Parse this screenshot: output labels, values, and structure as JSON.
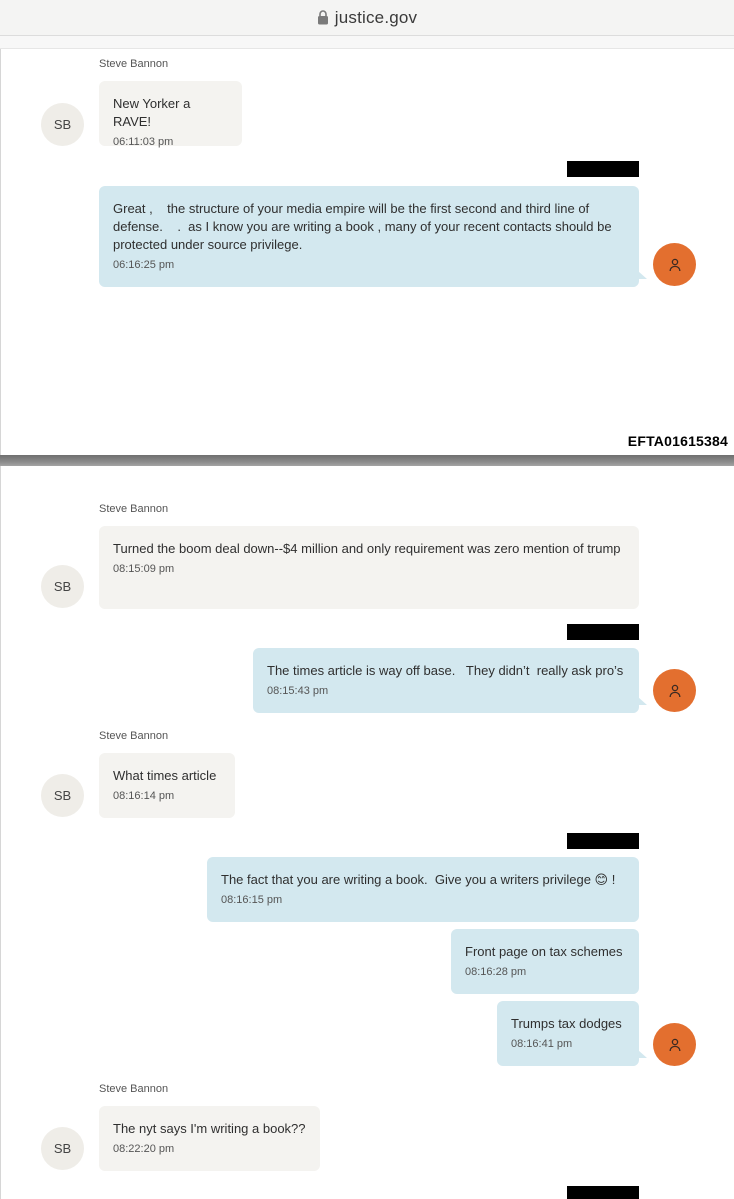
{
  "browser": {
    "url": "justice.gov"
  },
  "doc_id": "EFTA01615384",
  "contact": {
    "name": "Steve Bannon",
    "initials": "SB"
  },
  "page1": {
    "sender_1": "Steve Bannon",
    "msg_1": {
      "text": "New Yorker a RAVE!",
      "time": "06:11:03 pm"
    },
    "msg_2": {
      "text": "Great ,    the structure of your media empire will be the first second and third line of defense.    .  as I know you are writing a book , many of your recent contacts should be protected under source privilege.",
      "time": "06:16:25 pm"
    }
  },
  "page2": {
    "sender_1": "Steve Bannon",
    "msg_1": {
      "text": "Turned the boom deal down--$4 million and only requirement was zero mention of trump",
      "time": "08:15:09 pm"
    },
    "msg_2": {
      "text": "The times article is way off base.   They didn’t  really ask pro’s",
      "time": "08:15:43 pm"
    },
    "sender_2": "Steve Bannon",
    "msg_3": {
      "text": "What times article",
      "time": "08:16:14 pm"
    },
    "msg_4": {
      "text": "The fact that you are writing a book.  Give you a writers privilege 😊 !",
      "time": "08:16:15 pm"
    },
    "msg_5": {
      "text": "Front page on tax schemes",
      "time": "08:16:28 pm"
    },
    "msg_6": {
      "text": "Trumps tax dodges",
      "time": "08:16:41 pm"
    },
    "sender_3": "Steve Bannon",
    "msg_7": {
      "text": "The nyt says I'm writing a book??",
      "time": "08:22:20 pm"
    }
  }
}
